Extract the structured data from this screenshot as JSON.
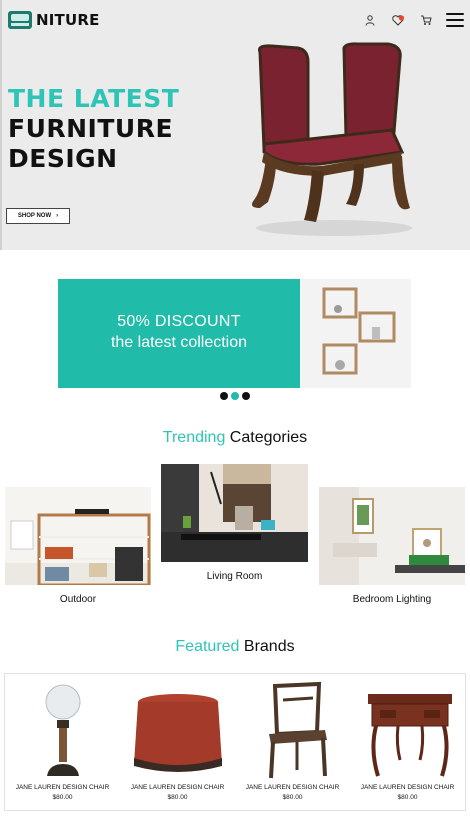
{
  "header": {
    "brand": "NITURE",
    "icons": [
      "bed-logo-icon",
      "user-icon",
      "heart-icon",
      "cart-icon",
      "menu-icon"
    ]
  },
  "hero": {
    "line1": "THE LATEST",
    "line2": "FURNITURE",
    "line3": "DESIGN",
    "button": "SHOP NOW"
  },
  "banner": {
    "title": "50% DISCOUNT",
    "subtitle": "the latest collection",
    "slides": 3,
    "active_slide": 2
  },
  "trending": {
    "title_accent": "Trending",
    "title_rest": " Categories",
    "categories": [
      {
        "label": "Outdoor"
      },
      {
        "label": "Living Room"
      },
      {
        "label": "Bedroom Lighting"
      }
    ]
  },
  "featured": {
    "title_accent": "Featured",
    "title_rest": " Brands",
    "products": [
      {
        "name": "JANE LAUREN DESIGN CHAIR",
        "price": "$80.00"
      },
      {
        "name": "JANE LAUREN DESIGN CHAIR",
        "price": "$80.00"
      },
      {
        "name": "JANE LAUREN DESIGN CHAIR",
        "price": "$80.00"
      },
      {
        "name": "JANE LAUREN DESIGN CHAIR",
        "price": "$80.00"
      }
    ]
  },
  "colors": {
    "accent": "#2ec4b6",
    "banner": "#21bba9",
    "hero_bg": "#ebebeb"
  }
}
